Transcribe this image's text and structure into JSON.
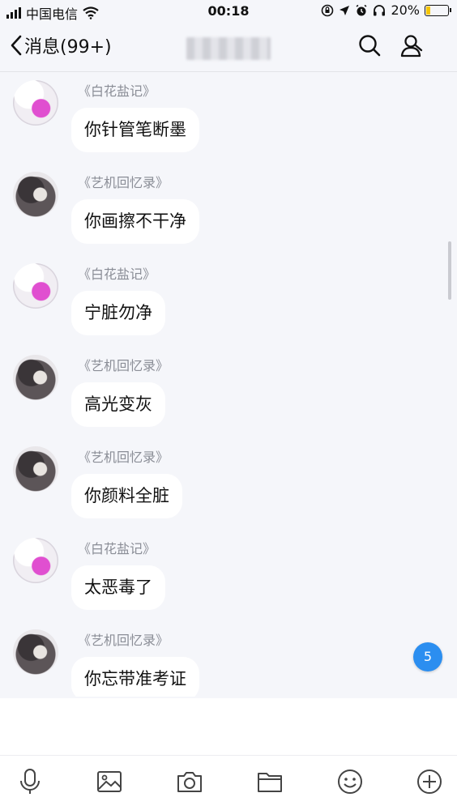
{
  "status_bar": {
    "carrier": "中国电信",
    "time": "00:18",
    "battery": "20%"
  },
  "nav": {
    "back_label": "消息(99+)",
    "title_icons": [
      "search-icon",
      "contact-icon"
    ]
  },
  "messages": [
    {
      "sender": "《白花盐记》",
      "text": "你针管笔断墨",
      "avatar": "white"
    },
    {
      "sender": "《艺机回忆录》",
      "text": "你画擦不干净",
      "avatar": "dark"
    },
    {
      "sender": "《白花盐记》",
      "text": "宁脏勿净",
      "avatar": "white"
    },
    {
      "sender": "《艺机回忆录》",
      "text": "高光变灰",
      "avatar": "dark"
    },
    {
      "sender": "《艺机回忆录》",
      "text": "你颜料全脏",
      "avatar": "dark"
    },
    {
      "sender": "《白花盐记》",
      "text": "太恶毒了",
      "avatar": "white"
    },
    {
      "sender": "《艺机回忆录》",
      "text": "你忘带准考证",
      "avatar": "dark"
    }
  ],
  "unread_count": "5",
  "toolbar": [
    "microphone-icon",
    "image-icon",
    "camera-icon",
    "folder-icon",
    "emoji-icon",
    "plus-icon"
  ]
}
